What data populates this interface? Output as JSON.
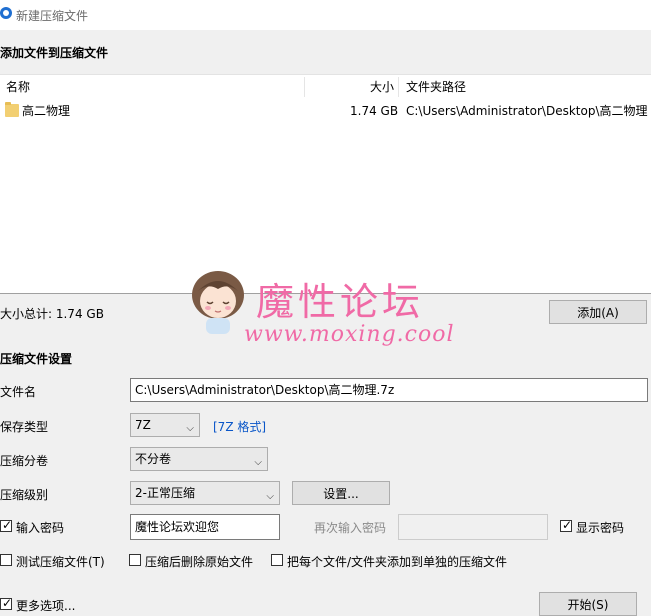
{
  "window": {
    "title": "新建压缩文件"
  },
  "add_files": {
    "heading": "添加文件到压缩文件",
    "columns": {
      "name": "名称",
      "size": "大小",
      "path": "文件夹路径"
    },
    "rows": [
      {
        "name": "高二物理",
        "size": "1.74 GB",
        "path": "C:\\Users\\Administrator\\Desktop\\高二物理"
      }
    ],
    "total_label": "大小总计: 1.74 GB",
    "add_button": "添加(A)"
  },
  "settings": {
    "heading": "压缩文件设置",
    "filename_label": "文件名",
    "filename_value": "C:\\Users\\Administrator\\Desktop\\高二物理.7z",
    "type_label": "保存类型",
    "type_value": "7Z",
    "format_link": "[7Z 格式]",
    "split_label": "压缩分卷",
    "split_value": "不分卷",
    "level_label": "压缩级别",
    "level_value": "2-正常压缩",
    "settings_button": "设置...",
    "password_checkbox": "输入密码",
    "password_value": "魔性论坛欢迎您",
    "reenter_label": "再次输入密码",
    "reenter_value": "",
    "show_password": "显示密码",
    "test_archive": "测试压缩文件(T)",
    "delete_after": "压缩后删除原始文件",
    "separate_archives": "把每个文件/文件夹添加到单独的压缩文件",
    "more_options": "更多选项...",
    "start_button": "开始(S)"
  },
  "watermark": {
    "title": "魔性论坛",
    "url": "www.moxing.cool"
  },
  "colors": {
    "accent": "#0a56c8",
    "watermark": "#f06aa6",
    "folder": "#f2cf72"
  }
}
